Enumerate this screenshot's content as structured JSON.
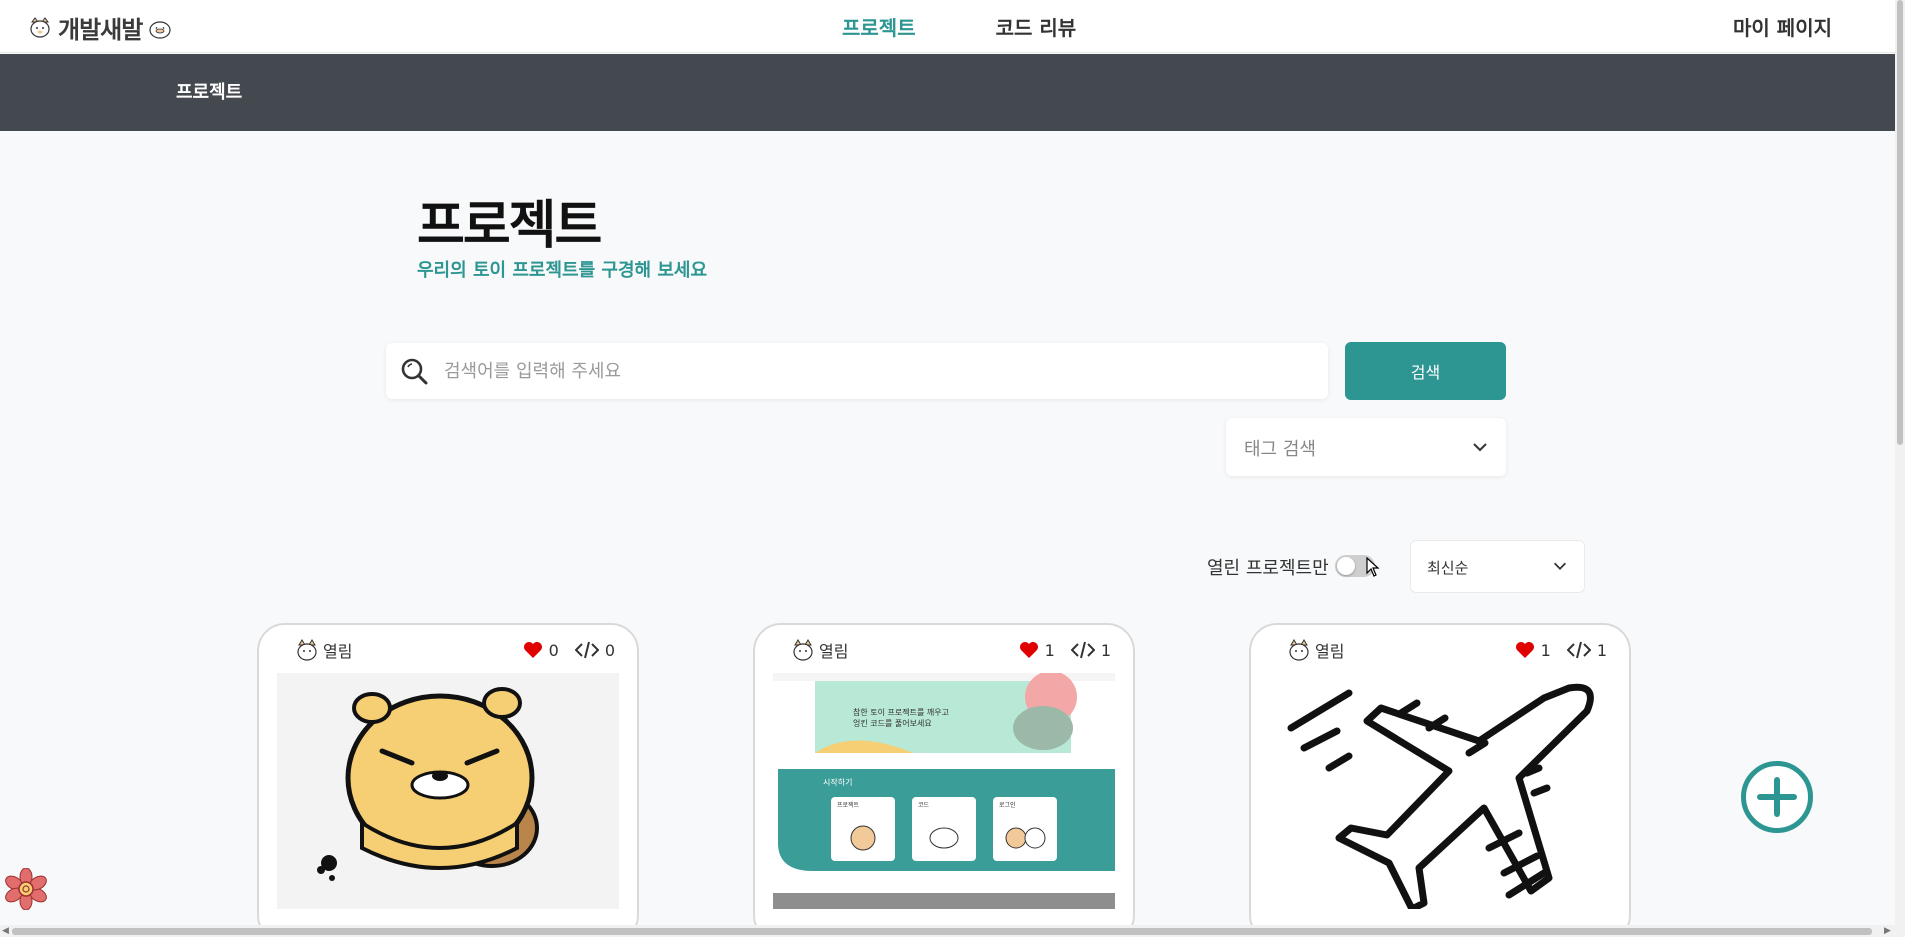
{
  "nav": {
    "logo_text": "개발새발",
    "links": [
      "프로젝트",
      "코드 리뷰"
    ],
    "active": "프로젝트",
    "mypage": "마이 페이지"
  },
  "subheader": {
    "title": "프로젝트"
  },
  "page": {
    "title": "프로젝트",
    "subtitle": "우리의 토이 프로젝트를 구경해 보세요"
  },
  "search": {
    "placeholder": "검색어를 입력해 주세요",
    "value": "",
    "button_label": "검색"
  },
  "tag_search": {
    "label": "태그 검색"
  },
  "filters": {
    "open_only_label": "열린 프로젝트만",
    "open_only_checked": false,
    "sort_label": "최신순"
  },
  "cards": [
    {
      "status": "열림",
      "likes": "0",
      "reviews": "0",
      "thumbnail": "yellow-character-illustration"
    },
    {
      "status": "열림",
      "likes": "1",
      "reviews": "1",
      "thumbnail": "website-screenshot"
    },
    {
      "status": "열림",
      "likes": "1",
      "reviews": "1",
      "thumbnail": "airplane-line-drawing"
    }
  ],
  "thumbnail_texts": {
    "promo_line1": "참한 토이 프로젝트를 깨우고",
    "promo_line2": "엉킨 코드를 풀어보세요",
    "start": "시작하기",
    "box1": "프로젝트",
    "box2": "코드",
    "box3": "로그인"
  },
  "colors": {
    "accent": "#2e9692",
    "subheader_bg": "#444950",
    "heart": "#e00000",
    "page_bg": "#f8f9fa"
  }
}
